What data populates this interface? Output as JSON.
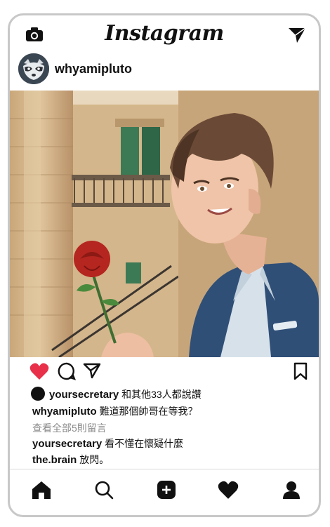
{
  "header": {
    "app_title": "Instagram"
  },
  "post": {
    "username": "whyamipluto",
    "likes_user": "yoursecretary",
    "likes_text": "和其他33人都說讚",
    "caption_user": "whyamipluto",
    "caption_text": "難道那個帥哥在等我？",
    "view_comments": "查看全部5則留言",
    "comments": [
      {
        "user": "yoursecretary",
        "text": "看不懂在懷疑什麼"
      },
      {
        "user": "the.brain",
        "text": "放閃。"
      }
    ]
  },
  "colors": {
    "like": "#e8304a",
    "text": "#111111",
    "muted": "#8a8a8a",
    "border": "#c8c8c8"
  },
  "icons": [
    "camera-icon",
    "send-icon",
    "heart-icon",
    "comment-icon",
    "share-icon",
    "bookmark-icon",
    "home-icon",
    "search-icon",
    "add-icon",
    "activity-icon",
    "profile-icon"
  ]
}
